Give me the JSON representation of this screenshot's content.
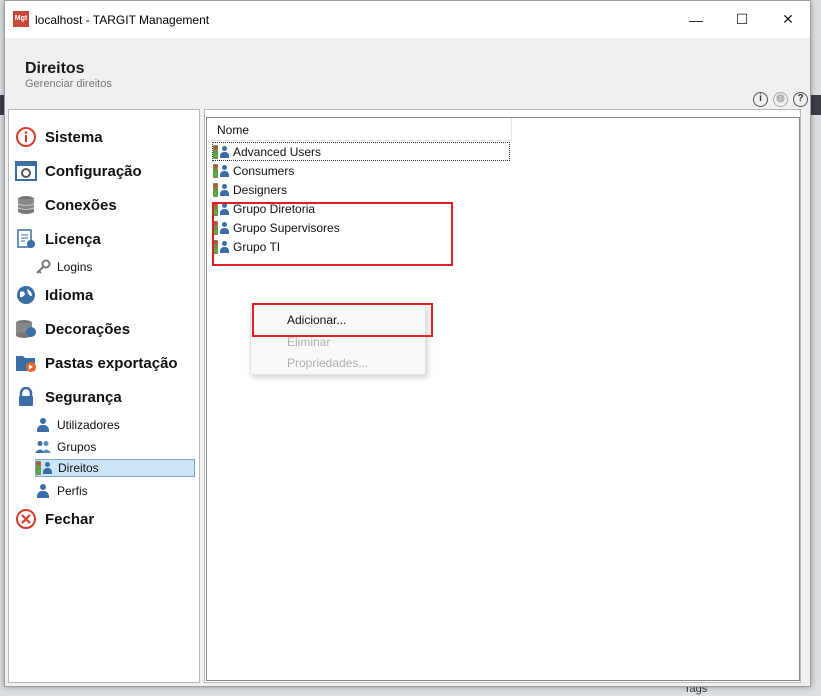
{
  "window": {
    "title": "localhost - TARGIT Management",
    "app_icon_text": "Mgt",
    "minimize": "—",
    "maximize": "☐",
    "close": "✕"
  },
  "header": {
    "title": "Direitos",
    "subtitle": "Gerenciar direitos"
  },
  "header_icons": [
    "info-icon",
    "globe-icon",
    "help-icon"
  ],
  "nav": {
    "sistema": "Sistema",
    "configuracao": "Configuração",
    "conexoes": "Conexões",
    "licenca": "Licença",
    "logins": "Logins",
    "idioma": "Idioma",
    "decoracoes": "Decorações",
    "pastas": "Pastas exportação",
    "seguranca": "Segurança",
    "utilizadores": "Utilizadores",
    "grupos": "Grupos",
    "direitos": "Direitos",
    "perfis": "Perfis",
    "fechar": "Fechar"
  },
  "list": {
    "column_header": "Nome",
    "rows": [
      "Advanced Users",
      "Consumers",
      "Designers",
      "Grupo Diretoria",
      "Grupo Supervisores",
      "Grupo TI"
    ]
  },
  "context_menu": {
    "adicionar": "Adicionar...",
    "eliminar": "Eliminar",
    "propriedades": "Propriedades..."
  },
  "background": {
    "tags_label": "Tags"
  },
  "colors": {
    "selection": "#cce4f7",
    "highlight_box": "#e01e24",
    "accent": "#3a6ea5"
  }
}
